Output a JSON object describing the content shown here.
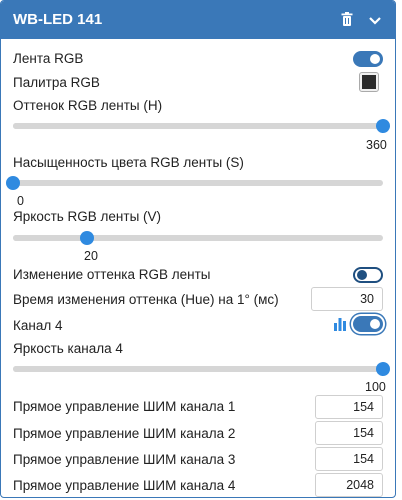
{
  "header": {
    "title": "WB-LED 141",
    "icons": [
      "trash-icon",
      "chevron-down-icon"
    ]
  },
  "controls": {
    "lenta_rgb": {
      "label": "Лента RGB",
      "state": "on"
    },
    "palitra_rgb": {
      "label": "Палитра RGB",
      "color": "#2b2b2b"
    },
    "hue": {
      "label": "Оттенок RGB ленты (H)",
      "value": "360",
      "min": 0,
      "max": 360
    },
    "saturation": {
      "label": "Насыщенность цвета RGB ленты (S)",
      "value": "0",
      "min": 0,
      "max": 100
    },
    "brightness": {
      "label": "Яркость RGB ленты (V)",
      "value": "20",
      "min": 0,
      "max": 100
    },
    "hue_change": {
      "label": "Изменение оттенка RGB ленты",
      "state": "off"
    },
    "hue_time": {
      "label": "Время изменения оттенка (Hue) на 1° (мс)",
      "value": "30"
    },
    "channel4": {
      "label": "Канал 4",
      "state": "on",
      "icon": "bar-chart-icon"
    },
    "channel4_brightness": {
      "label": "Яркость канала 4",
      "value": "100",
      "min": 0,
      "max": 100
    },
    "pwm1": {
      "label": "Прямое управление ШИМ канала 1",
      "value": "154"
    },
    "pwm2": {
      "label": "Прямое управление ШИМ канала 2",
      "value": "154"
    },
    "pwm3": {
      "label": "Прямое управление ШИМ канала 3",
      "value": "154"
    },
    "pwm4": {
      "label": "Прямое управление ШИМ канала 4",
      "value": "2048"
    }
  },
  "colors": {
    "accent": "#3a78b8",
    "thumb": "#2f8ae0",
    "track": "#d6d6d6"
  }
}
